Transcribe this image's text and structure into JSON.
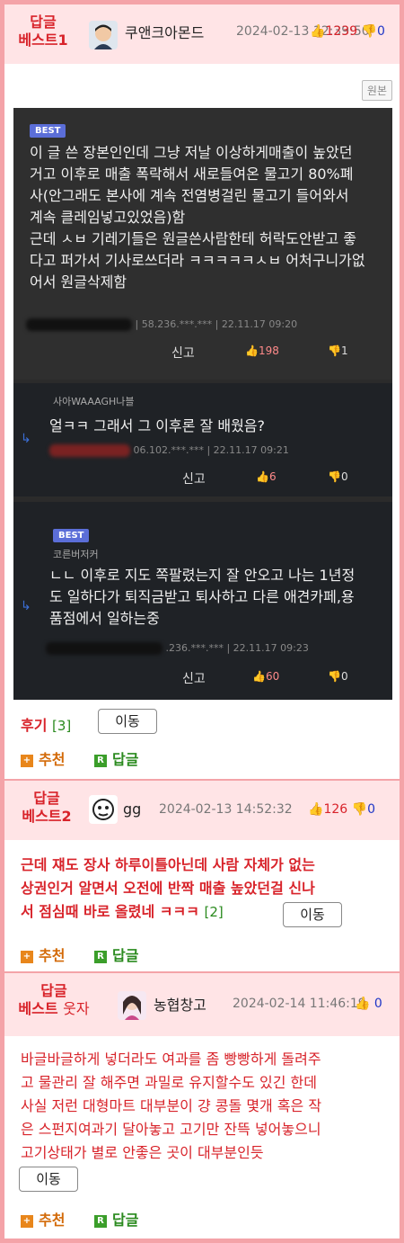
{
  "c1": {
    "label": [
      "답글",
      "베스트1"
    ],
    "nick": "쿠앤크아몬드",
    "date": "2024-02-13 12:39:50",
    "up": "1239",
    "down": "0",
    "orig_label": "원본",
    "best_tag": "BEST",
    "body": [
      "이 글 쓴 장본인인데 그냥 저날 이상하게매출이 높았던",
      "거고 이후로 매출 폭락해서 새로들여온 물고기 80%폐",
      "사(안그래도 본사에 계속 전염병걸린 물고기 들어와서",
      "계속 클레임넣고있었음)함",
      "근데 ㅅㅂ 기레기들은 원글쓴사람한테 허락도안받고 좋",
      "다고 퍼가서 기사로쓰더라 ㅋㅋㅋㅋㅋㅅㅂ 어처구니가없",
      "어서 원글삭제함"
    ],
    "meta": "| 58.236.***.*** | 22.11.17 09:20",
    "report": "신고",
    "c_up": "198",
    "c_down": "1",
    "replies": [
      {
        "name": "사아WAAAGH나블",
        "text": [
          "얼ㅋㅋ 그래서 그 이후론 잘 배웠음?"
        ],
        "meta": "06.102.***.*** | 22.11.17 09:21",
        "report": "신고",
        "up": "6",
        "down": "0"
      },
      {
        "best": "BEST",
        "name": "코른버저커",
        "text": [
          "ㄴㄴ 이후로 지도 쪽팔렸는지 잘 안오고 나는 1년정",
          "도 일하다가 퇴직금받고 퇴사하고 다른 애견카페,용",
          "품점에서 일하는중"
        ],
        "meta": ".236.***.*** | 22.11.17 09:23",
        "report": "신고",
        "up": "60",
        "down": "0"
      }
    ],
    "hugi": "후기",
    "hugi_count": "[3]",
    "move": "이동",
    "recommend": "추천",
    "reply": "답글"
  },
  "c2": {
    "label": [
      "답글",
      "베스트2"
    ],
    "nick": "gg",
    "date": "2024-02-13 14:52:32",
    "up": "126",
    "down": "0",
    "body": [
      "근데 쟤도 장사 하루이틀아닌데 사람 자체가 없는",
      "상권인거 알면서 오전에 반짝 매출 높았던걸 신나",
      "서 점심때 바로 올렸네 ㅋㅋㅋ"
    ],
    "count": "[2]",
    "move": "이동",
    "recommend": "추천",
    "reply": "답글"
  },
  "c3": {
    "label1": "답글",
    "label2": "베스트",
    "label_sub": "웃자",
    "nick": "농협창고",
    "date": "2024-02-14 11:46:19",
    "up": "",
    "down": "0",
    "body": [
      "바글바글하게 넣더라도 여과를 좀 빵빵하게 돌려주",
      "고 물관리 잘 해주면 과밀로 유지할수도 있긴 한데",
      "사실 저런 대형마트 대부분이 걍 콩돌 몇개 혹은 작",
      "은 스펀지여과기 달아놓고 고기만 잔뜩 넣어놓으니",
      "고기상태가 별로 안좋은 곳이 대부분인듯"
    ],
    "move": "이동",
    "recommend": "추천",
    "reply": "답글"
  },
  "colors": {
    "accent_red": "#d8232a",
    "border_pink": "#f4a3a8",
    "header_bg": "#ffe4e6",
    "dark_bg": "#2b2b2b",
    "best_blue": "#5b6ed8",
    "down_blue": "#1f36c7"
  }
}
